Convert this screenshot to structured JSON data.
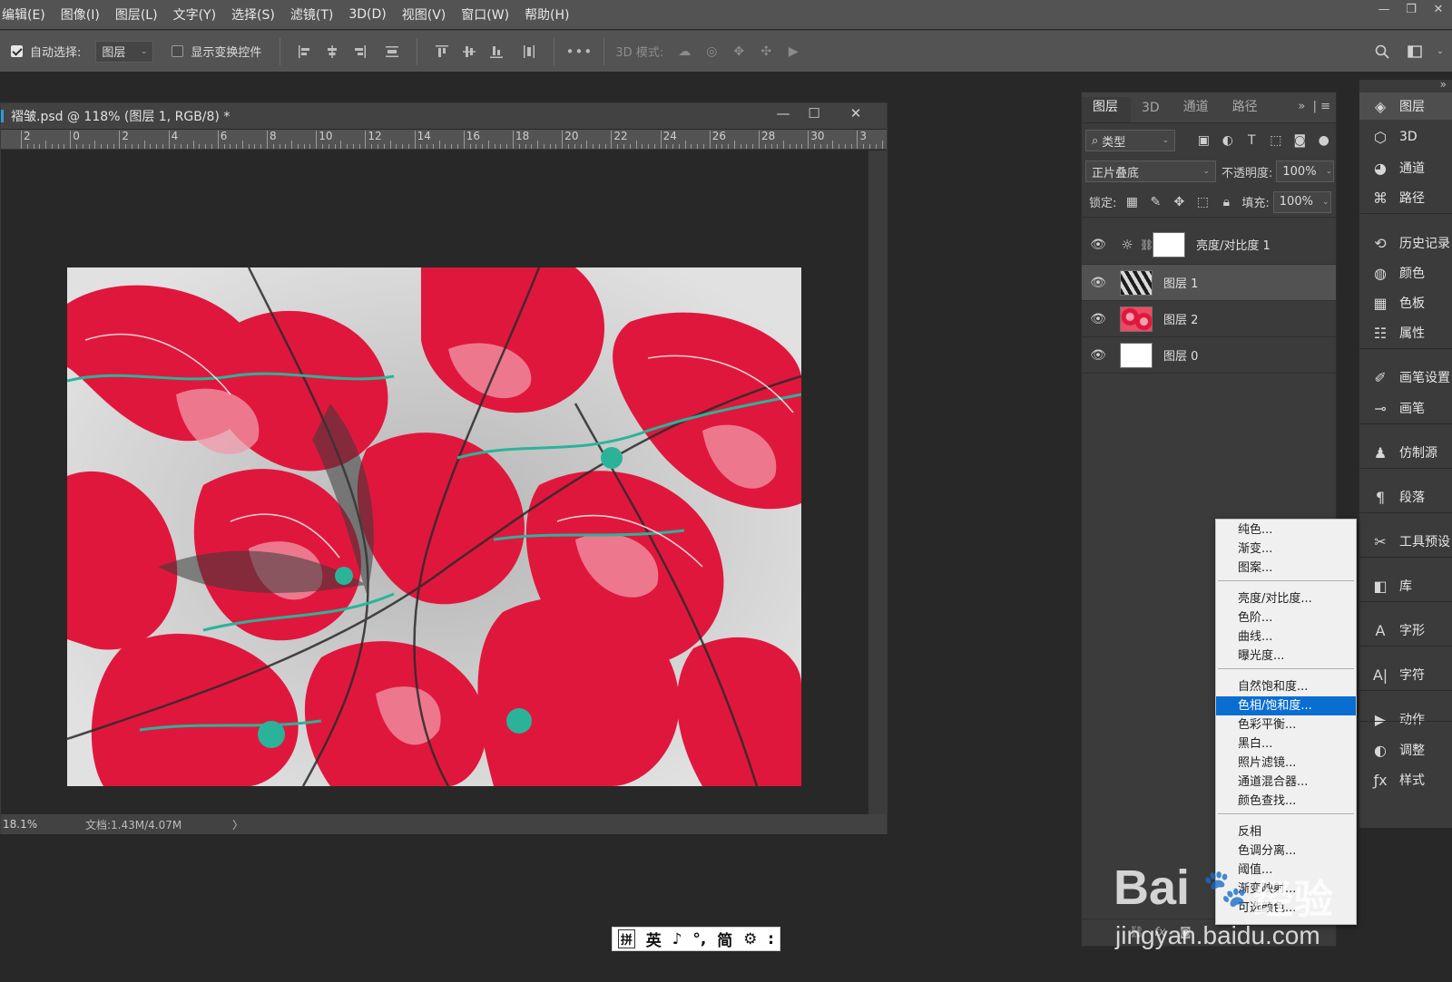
{
  "menubar": {
    "items": [
      "编辑(E)",
      "图像(I)",
      "图层(L)",
      "文字(Y)",
      "选择(S)",
      "滤镜(T)",
      "3D(D)",
      "视图(V)",
      "窗口(W)",
      "帮助(H)"
    ],
    "window_controls": [
      "—",
      "❐",
      "✕"
    ]
  },
  "options": {
    "auto_select_label": "自动选择:",
    "auto_select_checked": true,
    "auto_select_target": "图层",
    "show_transform_label": "显示变换控件",
    "show_transform_checked": false,
    "more_label": "•••",
    "mode3d_label": "3D 模式:"
  },
  "document": {
    "title": "褶皱.psd @ 118% (图层 1, RGB/8) *",
    "ruler_labels": [
      "2",
      "0",
      "2",
      "4",
      "6",
      "8",
      "10",
      "12",
      "14",
      "16",
      "18",
      "20",
      "22",
      "24",
      "26",
      "28",
      "30",
      "3"
    ],
    "zoom": "18.1%",
    "doc_info": "文档:1.43M/4.07M",
    "status_arrow": "〉"
  },
  "layers_panel": {
    "tabs": [
      "图层",
      "3D",
      "通道",
      "路径"
    ],
    "active_tab": 0,
    "filter_type": "类型",
    "blend_mode": "正片叠底",
    "opacity_label": "不透明度:",
    "opacity_value": "100%",
    "lock_label": "锁定:",
    "fill_label": "填充:",
    "fill_value": "100%",
    "layers": [
      {
        "name": "亮度/对比度 1",
        "kind": "adjustment",
        "selected": false
      },
      {
        "name": "图层 1",
        "kind": "pixel",
        "selected": true
      },
      {
        "name": "图层 2",
        "kind": "pixel",
        "selected": false
      },
      {
        "name": "图层 0",
        "kind": "white",
        "selected": false
      }
    ]
  },
  "dock": {
    "items": [
      {
        "label": "图层",
        "icon": "layers-icon",
        "active": true
      },
      {
        "label": "3D",
        "icon": "cube-icon",
        "active": false
      },
      {
        "label": "通道",
        "icon": "channels-icon",
        "active": false
      },
      {
        "label": "路径",
        "icon": "paths-icon",
        "active": false
      },
      {
        "label": "历史记录",
        "icon": "history-icon",
        "active": false
      },
      {
        "label": "颜色",
        "icon": "color-palette-icon",
        "active": false
      },
      {
        "label": "色板",
        "icon": "swatches-icon",
        "active": false
      },
      {
        "label": "属性",
        "icon": "properties-icon",
        "active": false
      },
      {
        "label": "画笔设置",
        "icon": "brush-settings-icon",
        "active": false
      },
      {
        "label": "画笔",
        "icon": "brush-icon",
        "active": false
      },
      {
        "label": "仿制源",
        "icon": "clone-source-icon",
        "active": false
      },
      {
        "label": "段落",
        "icon": "paragraph-icon",
        "active": false
      },
      {
        "label": "工具预设",
        "icon": "tool-presets-icon",
        "active": false
      },
      {
        "label": "库",
        "icon": "libraries-icon",
        "active": false
      },
      {
        "label": "字形",
        "icon": "glyphs-icon",
        "active": false
      },
      {
        "label": "字符",
        "icon": "character-icon",
        "active": false
      },
      {
        "label": "动作",
        "icon": "actions-icon",
        "active": false
      },
      {
        "label": "调整",
        "icon": "adjustments-icon",
        "active": false
      },
      {
        "label": "样式",
        "icon": "styles-icon",
        "active": false
      }
    ]
  },
  "context_menu": {
    "items": [
      "纯色...",
      "渐变...",
      "图案...",
      "亮度/对比度...",
      "色阶...",
      "曲线...",
      "曝光度...",
      "自然饱和度...",
      "色相/饱和度...",
      "色彩平衡...",
      "黑白...",
      "照片滤镜...",
      "通道混合器...",
      "颜色查找...",
      "反相",
      "色调分离...",
      "阈值...",
      "渐变映射...",
      "可选颜色..."
    ],
    "highlighted": 8
  },
  "ime": {
    "items": [
      "拼",
      "英",
      "♪",
      "°,",
      "简",
      "⚙",
      ":"
    ]
  },
  "watermark": {
    "brand": "Bai",
    "paw": "🐾",
    "cn": "经验",
    "url": "jingyan.baidu.com"
  },
  "colors": {
    "ui_bg": "#282828",
    "bar_bg": "#535353",
    "panel_bg": "#3b3b3b",
    "highlight": "#0a6ed1",
    "fabric_red": "#e0173c",
    "fabric_teal": "#2bb39a"
  }
}
